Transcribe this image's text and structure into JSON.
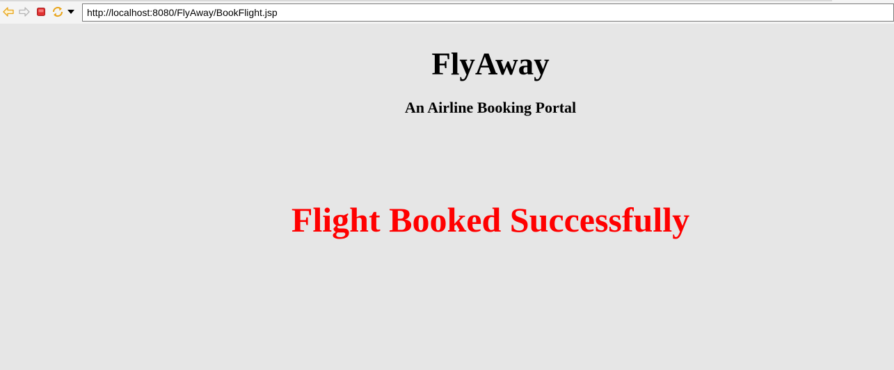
{
  "browser": {
    "url": "http://localhost:8080/FlyAway/BookFlight.jsp"
  },
  "page": {
    "title": "FlyAway",
    "subtitle": "An Airline Booking Portal",
    "message": "Flight Booked Successfully"
  },
  "colors": {
    "background": "#e6e6e6",
    "message": "#ff0000",
    "back_icon": "#e8a317",
    "stop_icon": "#e03131",
    "refresh_icon": "#e8a317"
  },
  "icons": {
    "back": "back-arrow-icon",
    "forward": "forward-arrow-icon",
    "stop": "stop-icon",
    "refresh": "refresh-icon",
    "dropdown": "dropdown-triangle-icon"
  }
}
